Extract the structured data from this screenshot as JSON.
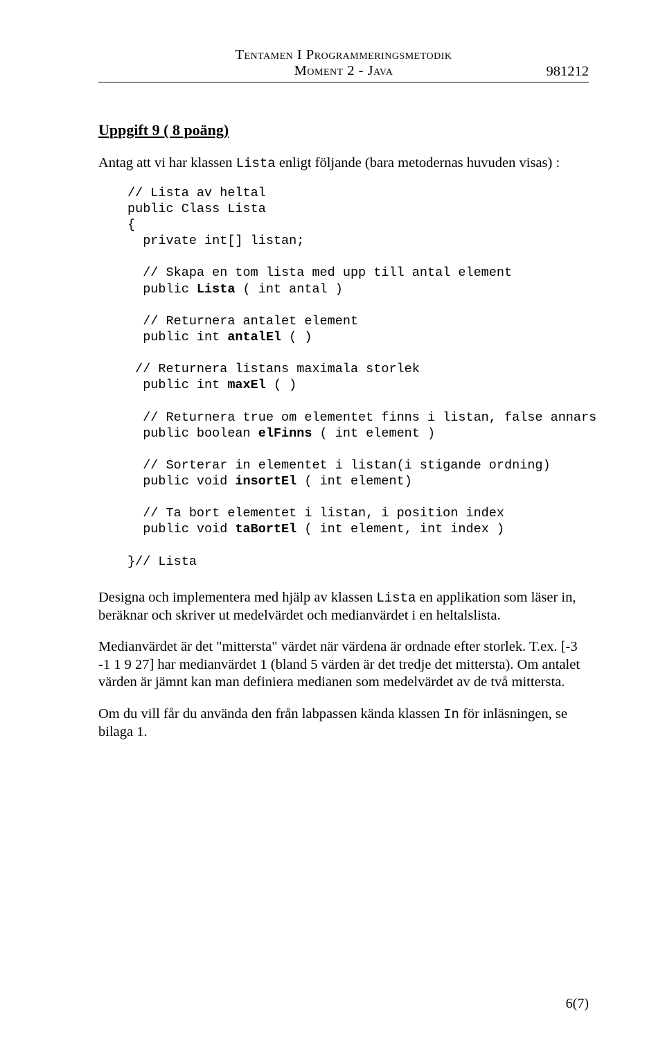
{
  "header": {
    "line1": "Tentamen I Programmeringsmetodik",
    "line2": "Moment 2 - Java",
    "code": "981212"
  },
  "task": {
    "title": "Uppgift 9 ( 8 poäng)",
    "intro_pre": "Antag att vi har klassen ",
    "intro_code": "Lista",
    "intro_post": " enligt följande (bara metodernas huvuden visas) :"
  },
  "code": {
    "c1": "// Lista av heltal",
    "c2": "public Class Lista",
    "c3": "{",
    "c4": "  private int[] listan;",
    "c5": "  // Skapa en tom lista med upp till antal element",
    "c6a": "  public ",
    "c6b": "Lista",
    "c6c": " ( int antal )",
    "c7": "  // Returnera antalet element",
    "c8a": "  public int ",
    "c8b": "antalEl",
    "c8c": " ( )",
    "c9": " // Returnera listans maximala storlek",
    "c10a": "  public int ",
    "c10b": "maxEl",
    "c10c": " ( )",
    "c11a": "  // Returnera true om elementet finns i listan, false annars",
    "c12a": "  public boolean ",
    "c12b": "elFinns",
    "c12c": " ( int element )",
    "c13": "  // Sorterar in elementet i listan(i stigande ordning)",
    "c14a": "  public void ",
    "c14b": "insortEl",
    "c14c": " ( int element)",
    "c15": "  // Ta bort elementet i listan, i position index",
    "c16a": "  public void ",
    "c16b": "taBortEl",
    "c16c": " ( int element, int index )",
    "c17": "}// Lista"
  },
  "paragraphs": {
    "p1_pre": "Designa och implementera med hjälp av klassen ",
    "p1_code": "Lista",
    "p1_post": " en applikation som läser in, beräknar och skriver ut medelvärdet och medianvärdet i en heltalslista.",
    "p2": "Medianvärdet är det \"mittersta\" värdet när värdena är ordnade efter storlek. T.ex. [-3 -1 1 9 27] har medianvärdet 1 (bland 5 värden är det tredje det mittersta). Om antalet värden är jämnt kan man definiera medianen som medelvärdet av de två mittersta.",
    "p3_pre": "Om du vill får du använda den från labpassen kända klassen ",
    "p3_code": "In",
    "p3_post": " för inläsningen, se bilaga 1."
  },
  "page_number": "6(7)"
}
